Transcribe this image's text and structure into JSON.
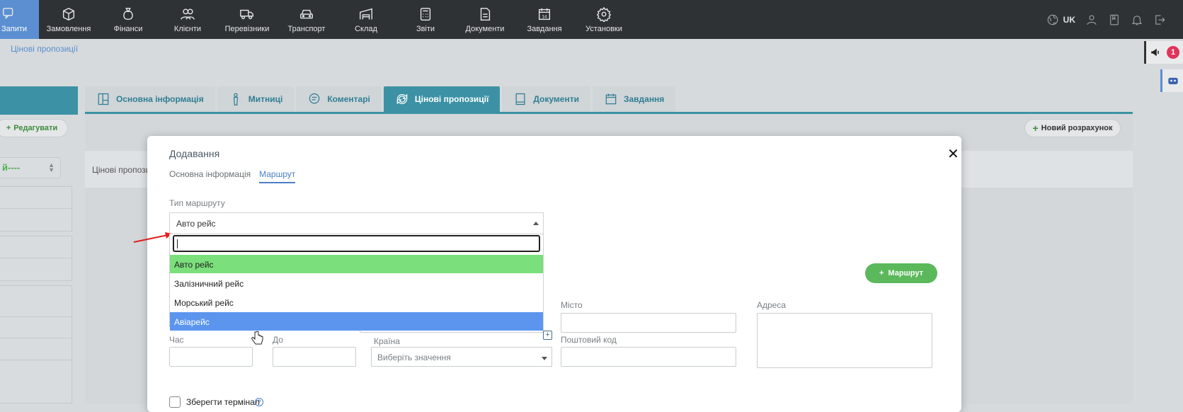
{
  "nav": {
    "items": [
      {
        "label": "Запити",
        "icon": "chat-question-icon"
      },
      {
        "label": "Замовлення",
        "icon": "package-icon"
      },
      {
        "label": "Фінанси",
        "icon": "money-bag-icon"
      },
      {
        "label": "Клієнти",
        "icon": "users-icon"
      },
      {
        "label": "Перевізники",
        "icon": "truck-icon"
      },
      {
        "label": "Транспорт",
        "icon": "car-icon"
      },
      {
        "label": "Склад",
        "icon": "warehouse-icon"
      },
      {
        "label": "Звіти",
        "icon": "calculator-icon"
      },
      {
        "label": "Документи",
        "icon": "document-icon"
      },
      {
        "label": "Завдання",
        "icon": "calendar-icon"
      },
      {
        "label": "Установки",
        "icon": "gear-icon"
      }
    ],
    "lang": "UK"
  },
  "breadcrumb": "Цінові пропозиції",
  "notifications_count": "1",
  "left_panel": {
    "edit_label": "Редагувати",
    "status_value": "й----"
  },
  "tabs": [
    {
      "label": "Основна інформація"
    },
    {
      "label": "Митниці"
    },
    {
      "label": "Коментарі"
    },
    {
      "label": "Цінові пропозиції"
    },
    {
      "label": "Документи"
    },
    {
      "label": "Завдання"
    }
  ],
  "new_calc_label": "Новий розрахунок",
  "panel_strip_text": "Цінові пропози",
  "modal": {
    "title": "Додавання",
    "tabs": [
      "Основна інформація",
      "Маршрут"
    ],
    "route_type_label": "Тип маршруту",
    "route_type_value": "Авто рейс",
    "options": [
      "Авто рейс",
      "Залізничний рейс",
      "Морський рейс",
      "Авіарейс"
    ],
    "route_button": "Маршрут",
    "city_label": "Місто",
    "address_label": "Адреса",
    "time_label": "Час",
    "to_label": "До",
    "country_label": "Країна",
    "country_placeholder": "Виберіть значення",
    "postal_label": "Поштовий код",
    "save_terminal_label": "Зберегти термінал",
    "help_mark": "?"
  },
  "colors": {
    "accent": "#3c92a4",
    "nav_active": "#5b8fd1",
    "option_selected": "#7bdf7b",
    "option_hover": "#5b95ee",
    "green_button": "#5bb85b"
  }
}
